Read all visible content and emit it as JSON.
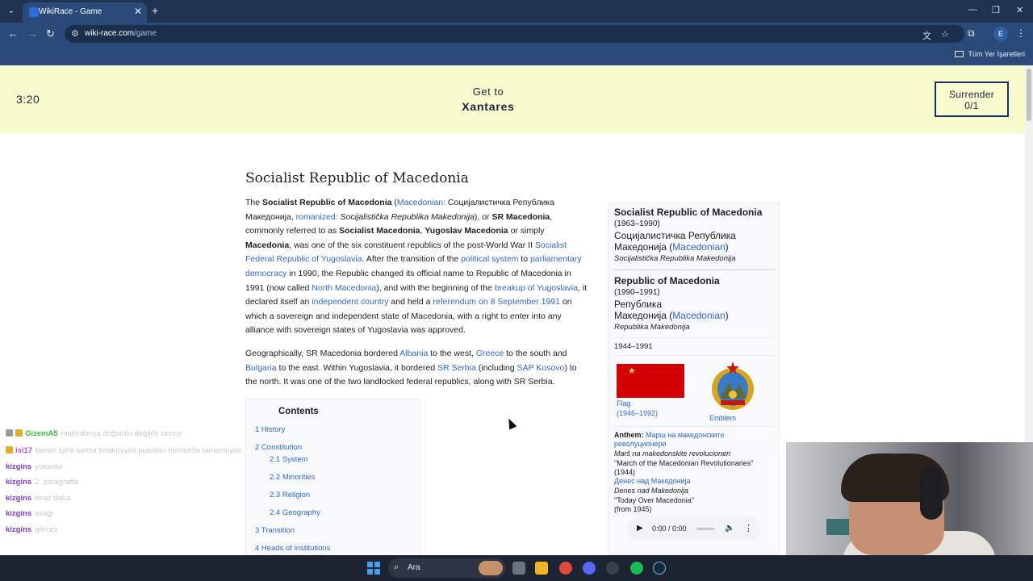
{
  "browser": {
    "tab_title": "WikiRace - Game",
    "url_host": "wiki-race.com",
    "url_path": "/game",
    "profile_initial": "E",
    "bookmarks_all": "Tüm Yer İşaretleri"
  },
  "game": {
    "timer": "3:20",
    "target_prefix": "Get to",
    "target_name": "Xantares",
    "surrender_label": "Surrender",
    "surrender_count": "0/1"
  },
  "article": {
    "title": "Socialist Republic of Macedonia",
    "p1": {
      "s1": "The ",
      "b1": "Socialist Republic of Macedonia",
      "s2": " (",
      "l1": "Macedonian:",
      "s3": " Социјалистичка Република Македонија, ",
      "l2": "romanized:",
      "i1": " Socijalistička Republika Makedonija",
      "s4": "), or ",
      "b2": "SR Macedonia",
      "s5": ", commonly referred to as ",
      "b3": "Socialist Macedonia",
      "s6": ", ",
      "b4": "Yugoslav Macedonia",
      "s7": " or simply ",
      "b5": "Macedonia",
      "s8": ", was one of the six constituent republics of the post-World War II ",
      "l3": "Socialist Federal Republic of Yugoslavia",
      "s9": ". After the transition of the ",
      "l4": "political system",
      "s10": " to ",
      "l5": "parliamentary democracy",
      "s11": " in 1990, the Republic changed its official name to Republic of Macedonia in 1991 (now called ",
      "l6": "North Macedonia",
      "s12": "), and with the beginning of the ",
      "l7": "breakup of Yugoslavia",
      "s13": ", it declared itself an ",
      "l8": "independent country",
      "s14": " and held a ",
      "l9": "referendum on 8 September 1991",
      "s15": " on which a sovereign and independent state of Macedonia, with a right to enter into any alliance with sovereign states of Yugoslavia was approved."
    },
    "p2": {
      "s1": "Geographically, SR Macedonia bordered ",
      "l1": "Albania",
      "s2": " to the west, ",
      "l2": "Greece",
      "s3": " to the south and ",
      "l3": "Bulgaria",
      "s4": " to the east. Within Yugoslavia, it bordered ",
      "l4": "SR Serbia",
      "s5": " (including ",
      "l5": "SAP Kosovo",
      "s6": ") to the north. It was one of the two landlocked federal republics, along with SR Serbia."
    },
    "toc": {
      "title": "Contents",
      "items": [
        "1 History",
        "2 Constitution",
        "2.1 System",
        "2.2 Minorities",
        "2.3 Religion",
        "2.4 Geography",
        "3 Transition",
        "4 Heads of institutions"
      ]
    }
  },
  "infobox": {
    "name1": "Socialist Republic of Macedonia",
    "years1": "(1963–1990)",
    "native1_a": "Социјалистичка Република",
    "native1_b": "Македонија (",
    "native_lang": "Macedonian",
    "native_close": ")",
    "roman1": "Socijalistička Republika Makedonija",
    "name2": "Republic of Macedonia",
    "years2": "(1990–1991)",
    "native2_a": "Република",
    "native2_b": "Македонија (",
    "roman2": "Republika Makedonija",
    "span": "1944–1991",
    "flag_caption_a": "Flag",
    "flag_caption_b": "(1946–1992)",
    "emblem_caption": "Emblem",
    "anthem_label": "Anthem:",
    "anthem1_a": "Марш на македонските",
    "anthem1_b": "револуционери",
    "anthem1_roman": "Marš na makedonskite revolucioneri",
    "anthem1_en": "\"March of the Macedonian Revolutionaries\"",
    "anthem1_year": "(1944)",
    "anthem2": "Денес над Македонија",
    "anthem2_roman": "Denes nad Makedonija",
    "anthem2_en": "\"Today Over Macedonia\"",
    "anthem2_year": "(from 1945)",
    "audio_time": "0:00 / 0:00"
  },
  "chat": [
    {
      "user": "GizemA5",
      "color": "#3fb83f",
      "msg": "makedonya doğumlu değildir bence"
    },
    {
      "user": "isi17",
      "color": "#b04fd6",
      "msg": "benim işimi sansa bırakmıyim puanları hemen9a tamamlıyim"
    },
    {
      "user": "kizgins",
      "color": "#7b3fd0",
      "msg": "yukarda"
    },
    {
      "user": "kizgins",
      "color": "#7b3fd0",
      "msg": "2. paragrafta"
    },
    {
      "user": "kizgins",
      "color": "#7b3fd0",
      "msg": "biraz daha"
    },
    {
      "user": "kizgins",
      "color": "#7b3fd0",
      "msg": "asagı"
    },
    {
      "user": "kizgins",
      "color": "#7b3fd0",
      "msg": "görcez"
    }
  ],
  "taskbar": {
    "search_label": "Ara"
  },
  "colors": {
    "game_header_bg": "#f8fbcd",
    "link": "#3366cc",
    "chrome_frame": "#2a4a7a"
  }
}
